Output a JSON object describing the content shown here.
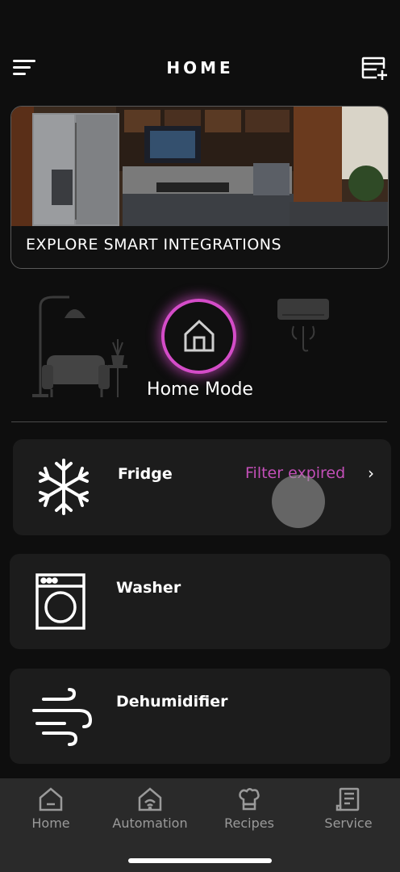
{
  "header": {
    "title": "HOME",
    "menu_icon": "hamburger-menu-icon",
    "add_icon": "add-appliance-icon"
  },
  "banner": {
    "label": "EXPLORE SMART INTEGRATIONS"
  },
  "mode": {
    "label": "Home Mode",
    "icon": "house-icon",
    "accent_color": "#d44cc8"
  },
  "appliances": [
    {
      "name": "Fridge",
      "icon": "snowflake-icon",
      "status": "Filter expired",
      "status_color": "#c34fb8"
    },
    {
      "name": "Washer",
      "icon": "washer-icon"
    },
    {
      "name": "Dehumidifier",
      "icon": "wind-icon"
    }
  ],
  "tabs": [
    {
      "label": "Home",
      "icon": "home-tab-icon"
    },
    {
      "label": "Automation",
      "icon": "automation-tab-icon"
    },
    {
      "label": "Recipes",
      "icon": "chef-hat-icon"
    },
    {
      "label": "Service",
      "icon": "service-tab-icon"
    }
  ]
}
